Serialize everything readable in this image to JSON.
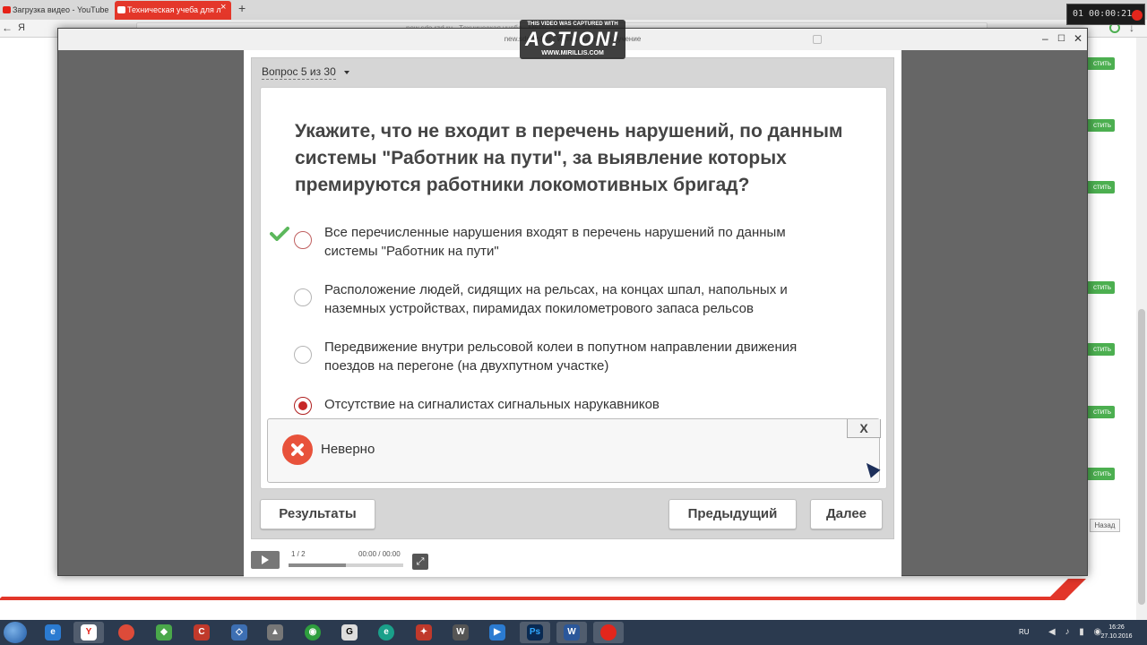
{
  "browser": {
    "tabs": [
      {
        "label": "Загрузка видео - YouTube",
        "active": false
      },
      {
        "label": "Техническая учеба для л",
        "active": true
      }
    ],
    "tab_close": "×",
    "new_tab": "+",
    "nav_back": "←",
    "nav_yandex": "Я",
    "url": "new.sdo.rzd.ru · Техническая учеба · МВПС Октябрь 2016",
    "download": "↓"
  },
  "recorder": {
    "banner_top": "THIS VIDEO WAS CAPTURED WITH",
    "logo": "ACTION!",
    "site": "WWW.MIRILLIS.COM",
    "timer": "01 00:00:21"
  },
  "modal": {
    "title": "new.sdo.rzd.ru · Интерактивное обучение",
    "minimize": "–",
    "maximize": "☐",
    "close": "✕"
  },
  "quiz": {
    "counter": "Вопрос 5 из 30",
    "question": "Укажите, что не входит в перечень нарушений, по данным системы \"Работник на пути\", за выявление которых премируются работники локомотивных бригад?",
    "options": [
      {
        "label": "Все перечисленные нарушения входят в перечень нарушений по данным системы \"Работник на пути\"",
        "correct": true,
        "selected": false
      },
      {
        "label": "Расположение людей, сидящих на рельсах, на концах шпал, напольных и наземных устройствах, пирамидах покилометрового запаса рельсов",
        "correct": false,
        "selected": false
      },
      {
        "label": "Передвижение внутри рельсовой колеи в попутном направлении движения поездов на перегоне (на двухпутном участке)",
        "correct": false,
        "selected": false
      },
      {
        "label": "Отсутствие на сигналистах сигнальных нарукавников",
        "correct": false,
        "selected": true
      }
    ],
    "feedback": {
      "status": "Неверно",
      "close_label": "X",
      "color": "#e8523b"
    },
    "buttons": {
      "results": "Результаты",
      "previous": "Предыдущий",
      "next": "Далее"
    }
  },
  "player_controls": {
    "slides": "1 / 2",
    "time": "00:00 / 00:00",
    "progress": 0.5
  },
  "page_behind": {
    "side_button_label": "стить",
    "back_button": "Назад"
  },
  "taskbar": {
    "items": [
      "ie-icon",
      "yandex-browser-icon",
      "chrome-icon",
      "hamster-icon",
      "ccleaner-icon",
      "network-icon",
      "rail-icon",
      "wifi-icon",
      "g-icon",
      "edge-icon",
      "cube-icon",
      "wot-icon",
      "play-icon",
      "photoshop-icon",
      "word-icon",
      "record-icon"
    ],
    "active": [
      "yandex-browser-icon",
      "photoshop-icon",
      "word-icon",
      "record-icon"
    ],
    "lang": "RU",
    "time": "16:26",
    "date": "27.10.2016"
  },
  "colors": {
    "accent_red": "#e4372a",
    "correct_green": "#5cb85c",
    "selected_red": "#c62828",
    "side_button_green": "#4caf50"
  }
}
